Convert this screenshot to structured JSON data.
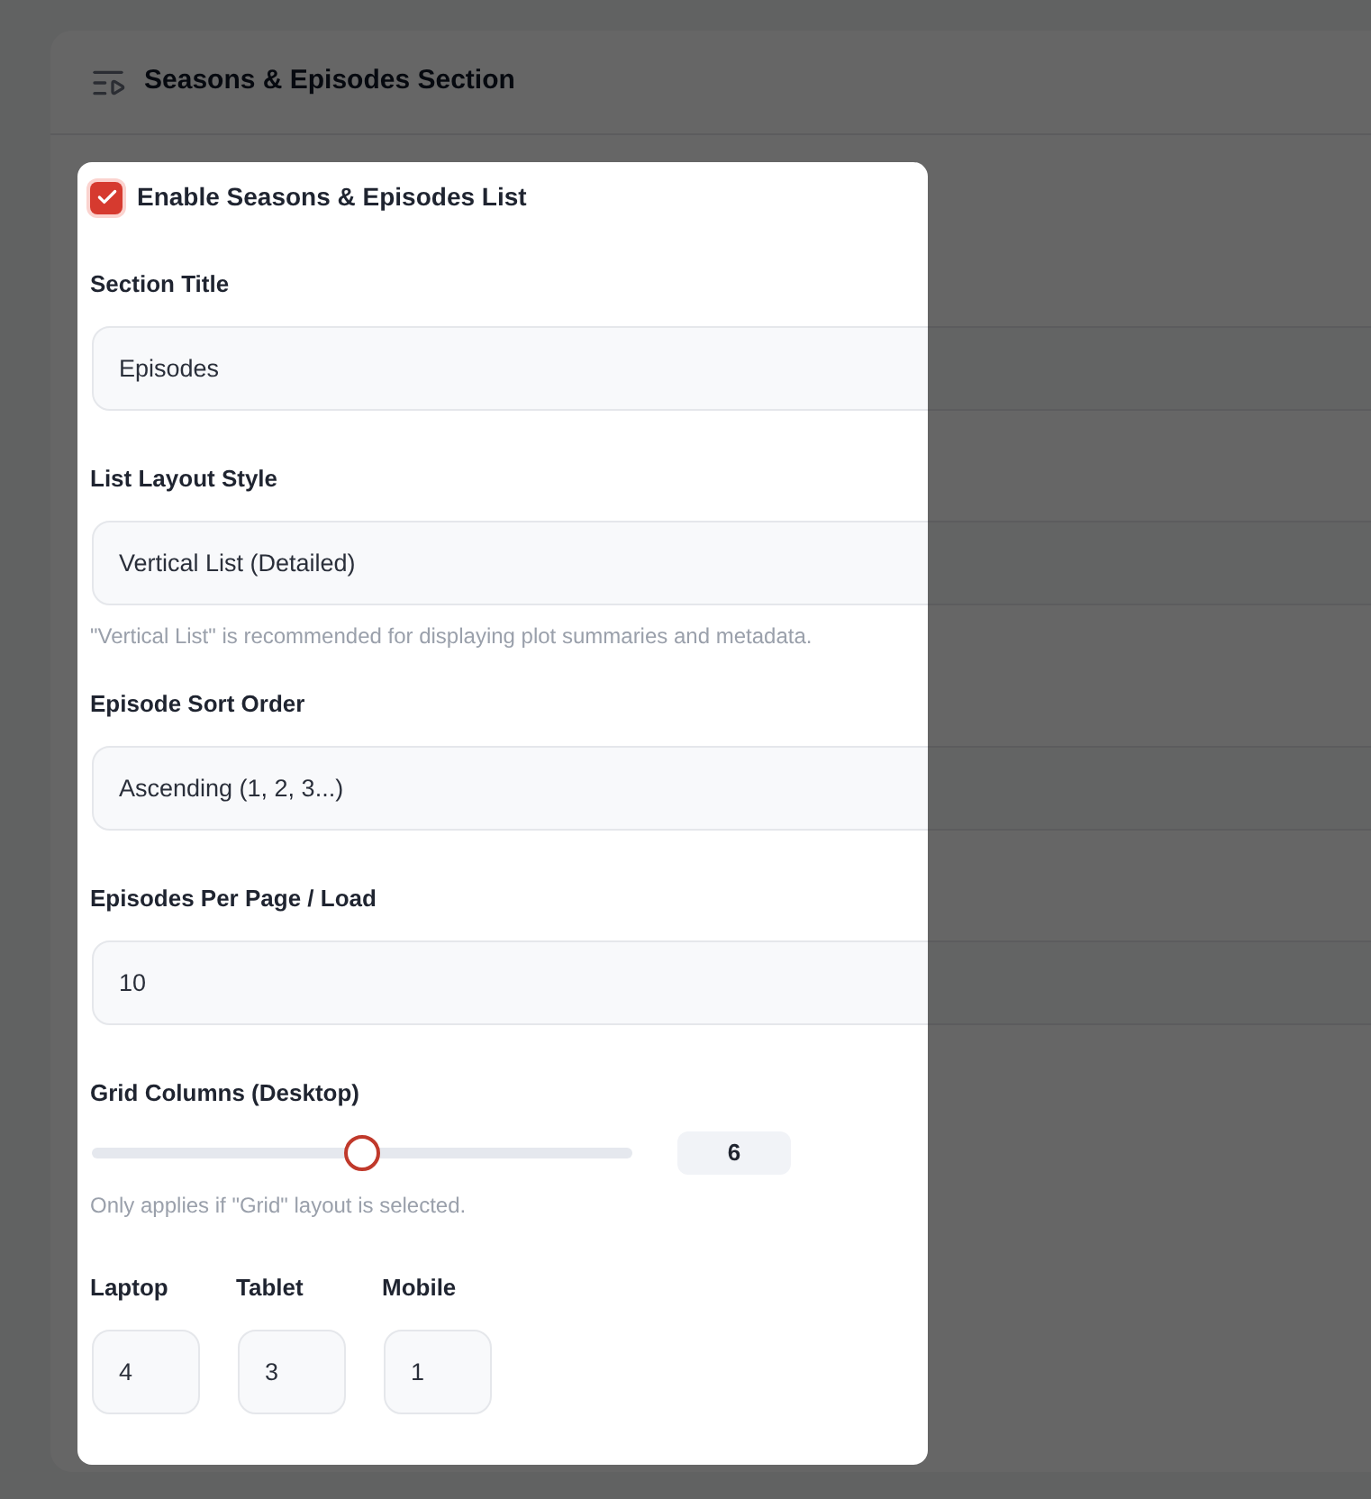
{
  "header": {
    "title": "Seasons & Episodes Section"
  },
  "enable": {
    "label": "Enable Seasons & Episodes List",
    "checked": true
  },
  "fields": [
    {
      "kind": "input",
      "label": "Section Title",
      "value": "Episodes"
    },
    {
      "kind": "input",
      "label": "List Layout Style",
      "value": "Vertical List (Detailed)",
      "help": "\"Vertical List\" is recommended for displaying plot summaries and metadata."
    },
    {
      "kind": "input",
      "label": "Episode Sort Order",
      "value": "Ascending (1, 2, 3...)"
    },
    {
      "kind": "input",
      "label": "Episodes Per Page / Load",
      "value": "10"
    },
    {
      "kind": "slider",
      "label": "Grid Columns (Desktop)",
      "level": 0.5,
      "reading": "6",
      "help": "Only applies if \"Grid\" layout is selected."
    },
    {
      "kind": "group",
      "items": [
        {
          "label": "Laptop",
          "value": "4"
        },
        {
          "label": "Tablet",
          "value": "3"
        },
        {
          "label": "Mobile",
          "value": "1"
        }
      ]
    }
  ]
}
